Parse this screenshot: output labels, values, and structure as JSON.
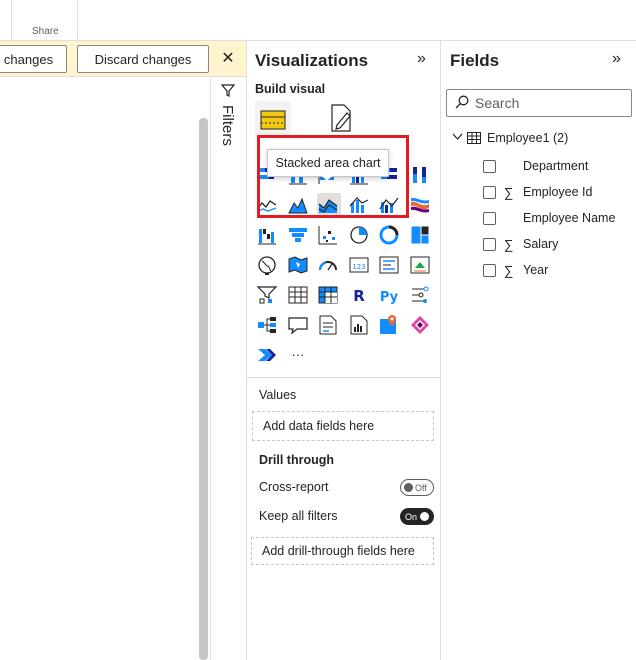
{
  "ribbon": {
    "share_label": "Share"
  },
  "notification": {
    "keep_label": "changes",
    "discard_label": "Discard changes",
    "close_glyph": "✕"
  },
  "filters": {
    "label": "Filters"
  },
  "visualizations": {
    "title": "Visualizations",
    "collapse_glyph": "»",
    "build_visual_label": "Build visual",
    "tooltip": "Stacked area chart",
    "more_glyph": "···",
    "values_label": "Values",
    "values_placeholder": "Add data fields here",
    "drill_through_label": "Drill through",
    "cross_report_label": "Cross-report",
    "cross_report_state": "Off",
    "keep_filters_label": "Keep all filters",
    "keep_filters_state": "On",
    "drill_placeholder": "Add drill-through fields here"
  },
  "fields": {
    "title": "Fields",
    "collapse_glyph": "»",
    "search_placeholder": "Search",
    "table_name": "Employee1 (2)",
    "items": [
      {
        "label": "Department",
        "sigma": ""
      },
      {
        "label": "Employee Id",
        "sigma": "∑"
      },
      {
        "label": "Employee Name",
        "sigma": ""
      },
      {
        "label": "Salary",
        "sigma": "∑"
      },
      {
        "label": "Year",
        "sigma": "∑"
      }
    ]
  },
  "colors": {
    "accent_yellow": "#f2c811",
    "brand_blue": "#118dff",
    "highlight_red": "#e51b24",
    "notify_bg": "#fff4ce"
  }
}
